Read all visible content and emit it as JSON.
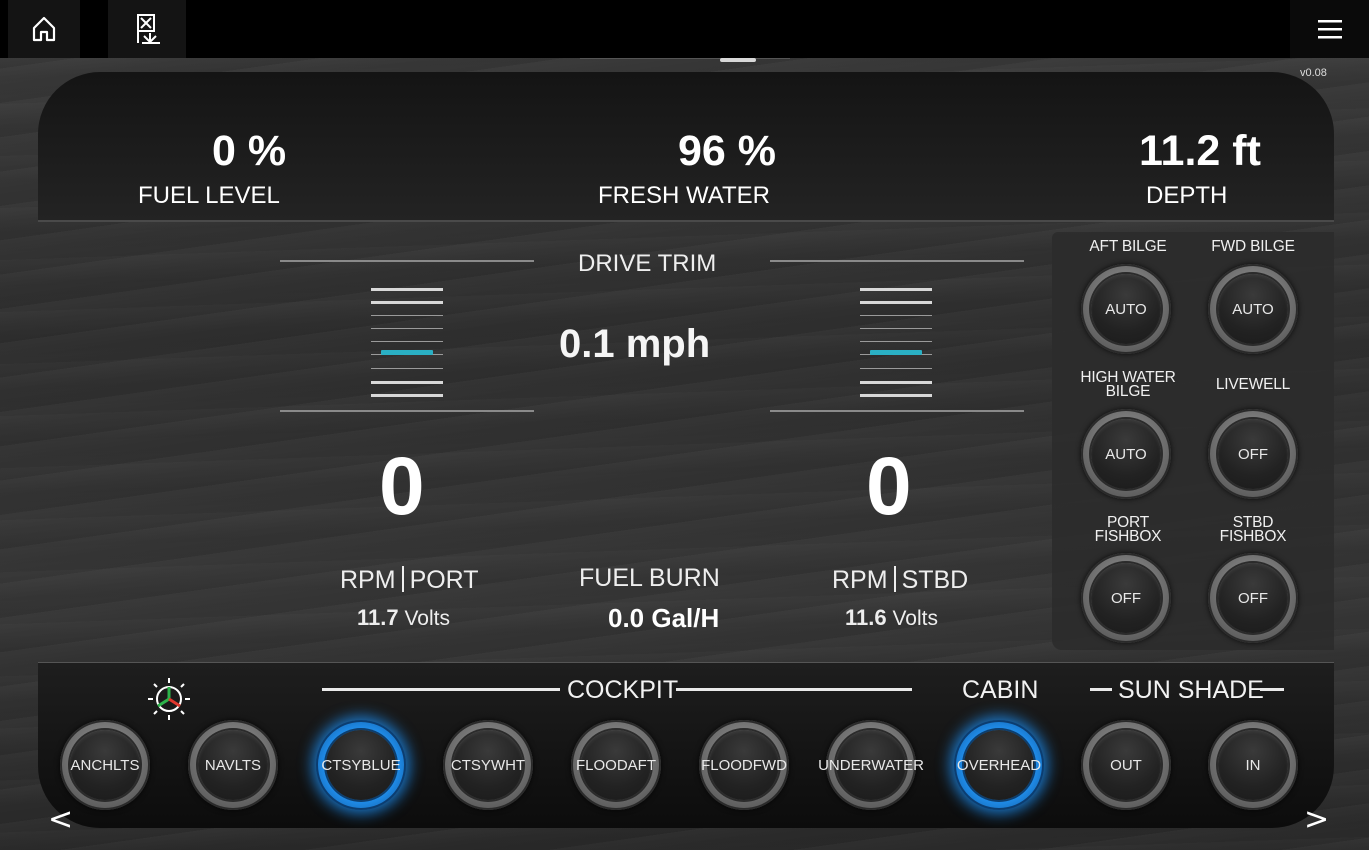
{
  "version": "v0.08",
  "header": {
    "fuel_level": {
      "value": "0 %",
      "label": "FUEL LEVEL"
    },
    "fresh_water": {
      "value": "96 %",
      "label": "FRESH WATER"
    },
    "depth": {
      "value": "11.2 ft",
      "label": "DEPTH"
    }
  },
  "drive_trim": {
    "title": "DRIVE TRIM",
    "speed": "0.1 mph",
    "port_trim_level": 0.6,
    "stbd_trim_level": 0.6
  },
  "engines": {
    "port": {
      "rpm": "0",
      "rpm_label": "RPM",
      "side_label": "PORT",
      "volts_value": "11.7",
      "volts_unit": "Volts"
    },
    "stbd": {
      "rpm": "0",
      "rpm_label": "RPM",
      "side_label": "STBD",
      "volts_value": "11.6",
      "volts_unit": "Volts"
    }
  },
  "fuel_burn": {
    "label": "FUEL BURN",
    "value": "0.0 Gal/H"
  },
  "pumps": [
    {
      "label": "AFT BILGE",
      "state": "AUTO"
    },
    {
      "label": "FWD BILGE",
      "state": "AUTO"
    },
    {
      "label_line1": "HIGH WATER",
      "label_line2": "BILGE",
      "state": "AUTO"
    },
    {
      "label": "LIVEWELL",
      "state": "OFF"
    },
    {
      "label_line1": "PORT",
      "label_line2": "FISHBOX",
      "state": "OFF"
    },
    {
      "label_line1": "STBD",
      "label_line2": "FISHBOX",
      "state": "OFF"
    }
  ],
  "groups": {
    "cockpit": "COCKPIT",
    "cabin": "CABIN",
    "sun_shade": "SUN SHADE"
  },
  "lights": [
    {
      "line1": "ANCH",
      "line2": "LTS",
      "on": false
    },
    {
      "line1": "NAV",
      "line2": "LTS",
      "on": false
    },
    {
      "line1": "CTSY",
      "line2": "BLUE",
      "on": true
    },
    {
      "line1": "CTSY",
      "line2": "WHT",
      "on": false
    },
    {
      "line1": "FLOOD",
      "line2": "AFT",
      "on": false
    },
    {
      "line1": "FLOOD",
      "line2": "FWD",
      "on": false
    },
    {
      "line1": "UNDER",
      "line2": "WATER",
      "on": false
    },
    {
      "line1": "OVER",
      "line2": "HEAD",
      "on": true
    },
    {
      "line1": "OUT",
      "on": false
    },
    {
      "line1": "IN",
      "on": false
    }
  ],
  "nav": {
    "prev": "<",
    "next": ">"
  },
  "colors": {
    "accent_blue": "#1f8ae6",
    "trim_marker": "#2ab0c4"
  }
}
